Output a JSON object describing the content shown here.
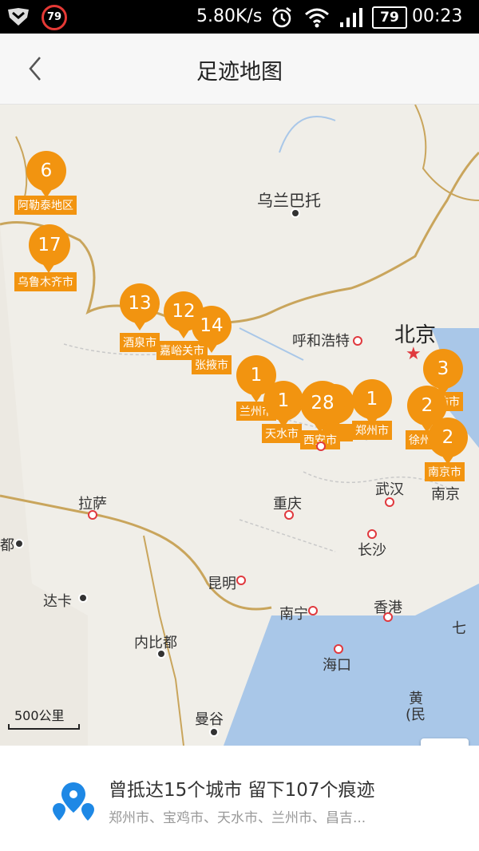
{
  "status_bar": {
    "badge": "79",
    "speed": "5.80K/s",
    "battery": "79",
    "time": "00:23",
    "icons": [
      "shield-icon",
      "alarm-icon",
      "wifi-icon",
      "signal-icon",
      "battery-icon"
    ]
  },
  "header": {
    "title": "足迹地图",
    "back_icon": "chevron-left-icon"
  },
  "map": {
    "labels": {
      "wulanbatuo": "乌兰巴托",
      "beijing": "北京",
      "huhehaote": "呼和浩特",
      "lasa": "拉萨",
      "chongqing": "重庆",
      "wuhan": "武汉",
      "nanjing": "南京",
      "changsha": "长沙",
      "kunming": "昆明",
      "daka": "达卡",
      "nanning": "南宁",
      "xianggang": "香港",
      "neibidu": "内比都",
      "haikou": "海口",
      "mangu": "曼谷",
      "du": "都",
      "qi": "七",
      "huang": "黄",
      "min": "(民"
    },
    "markers": [
      {
        "count": "6",
        "label": "阿勒泰地区"
      },
      {
        "count": "17",
        "label": "乌鲁木齐市"
      },
      {
        "count": "13",
        "label": "酒泉市"
      },
      {
        "count": "12",
        "label": "嘉峪关市"
      },
      {
        "count": "14",
        "label": "张掖市"
      },
      {
        "count": "1",
        "label": "兰州市"
      },
      {
        "count": "1",
        "label": "天水市"
      },
      {
        "count": "28",
        "label": "西安市"
      },
      {
        "count": "1",
        "label": "郑州市"
      },
      {
        "count": "3",
        "label": "潍坊市"
      },
      {
        "count": "2",
        "label": "徐州"
      },
      {
        "count": "2",
        "label": "南京市"
      }
    ],
    "scale_label": "500公里",
    "zoom_in": "+",
    "zoom_out": "−"
  },
  "summary": {
    "title": "曾抵达15个城市 留下107个痕迹",
    "cities": "郑州市、宝鸡市、天水市、兰州市、昌吉..."
  },
  "colors": {
    "marker": "#f29410",
    "accent_blue": "#1e88e5",
    "map_bg": "#f0eee8"
  }
}
